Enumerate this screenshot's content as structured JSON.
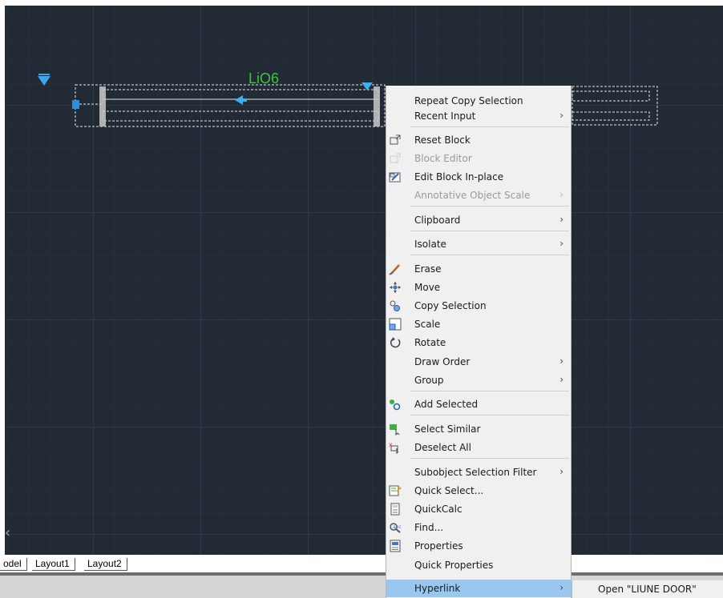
{
  "drawing": {
    "block_label": "LiO6",
    "block_label_color": "#37c837",
    "grip_color": "#2b8ee0"
  },
  "layout_tabs": [
    "odel",
    "Layout1",
    "Layout2"
  ],
  "context_menu": {
    "items": [
      {
        "label": "Repeat Copy Selection",
        "arrow": false,
        "disabled": false,
        "icon": ""
      },
      {
        "label": "Recent Input",
        "arrow": true,
        "disabled": false,
        "icon": ""
      },
      {
        "label": "Reset Block",
        "arrow": false,
        "disabled": false,
        "icon": "reset-block-icon"
      },
      {
        "label": "Block Editor",
        "arrow": false,
        "disabled": true,
        "icon": "block-editor-icon"
      },
      {
        "label": "Edit Block In-place",
        "arrow": false,
        "disabled": false,
        "icon": "edit-block-inplace-icon"
      },
      {
        "label": "Annotative Object Scale",
        "arrow": true,
        "disabled": true,
        "icon": ""
      },
      {
        "label": "Clipboard",
        "arrow": true,
        "disabled": false,
        "icon": ""
      },
      {
        "label": "Isolate",
        "arrow": true,
        "disabled": false,
        "icon": ""
      },
      {
        "label": "Erase",
        "arrow": false,
        "disabled": false,
        "icon": "erase-icon"
      },
      {
        "label": "Move",
        "arrow": false,
        "disabled": false,
        "icon": "move-icon"
      },
      {
        "label": "Copy Selection",
        "arrow": false,
        "disabled": false,
        "icon": "copy-selection-icon"
      },
      {
        "label": "Scale",
        "arrow": false,
        "disabled": false,
        "icon": "scale-icon"
      },
      {
        "label": "Rotate",
        "arrow": false,
        "disabled": false,
        "icon": "rotate-icon"
      },
      {
        "label": "Draw Order",
        "arrow": true,
        "disabled": false,
        "icon": ""
      },
      {
        "label": "Group",
        "arrow": true,
        "disabled": false,
        "icon": ""
      },
      {
        "label": "Add Selected",
        "arrow": false,
        "disabled": false,
        "icon": "add-selected-icon"
      },
      {
        "label": "Select Similar",
        "arrow": false,
        "disabled": false,
        "icon": "select-similar-icon"
      },
      {
        "label": "Deselect All",
        "arrow": false,
        "disabled": false,
        "icon": "deselect-all-icon"
      },
      {
        "label": "Subobject Selection Filter",
        "arrow": true,
        "disabled": false,
        "icon": ""
      },
      {
        "label": "Quick Select...",
        "arrow": false,
        "disabled": false,
        "icon": "quick-select-icon"
      },
      {
        "label": "QuickCalc",
        "arrow": false,
        "disabled": false,
        "icon": "quickcalc-icon"
      },
      {
        "label": "Find...",
        "arrow": false,
        "disabled": false,
        "icon": "find-icon"
      },
      {
        "label": "Properties",
        "arrow": false,
        "disabled": false,
        "icon": "properties-icon"
      },
      {
        "label": "Quick Properties",
        "arrow": false,
        "disabled": false,
        "icon": ""
      },
      {
        "label": "Hyperlink",
        "arrow": true,
        "disabled": false,
        "icon": "",
        "highlighted": true
      }
    ],
    "arrow_glyph": "›"
  },
  "hyperlink_submenu": {
    "open_label": "Open \"LIUNE DOOR\""
  },
  "colors": {
    "canvas_bg": "#222a35",
    "menu_bg": "#f0f0f0",
    "menu_highlight": "#99c7f0"
  }
}
